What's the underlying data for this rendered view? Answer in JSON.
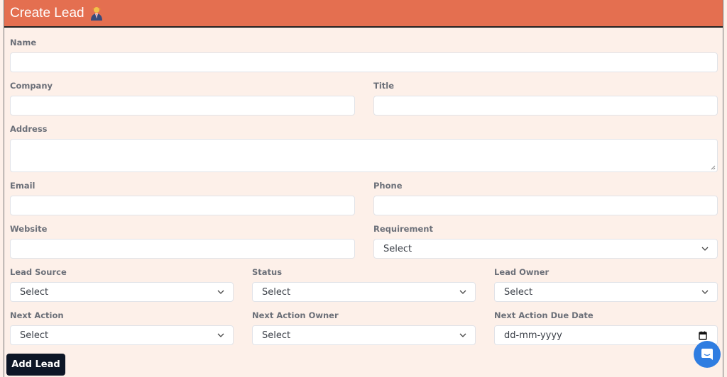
{
  "header": {
    "title": "Create Lead",
    "icon": "businessman-icon"
  },
  "fields": {
    "name": {
      "label": "Name",
      "value": ""
    },
    "company": {
      "label": "Company",
      "value": ""
    },
    "title": {
      "label": "Title",
      "value": ""
    },
    "address": {
      "label": "Address",
      "value": ""
    },
    "email": {
      "label": "Email",
      "value": ""
    },
    "phone": {
      "label": "Phone",
      "value": ""
    },
    "website": {
      "label": "Website",
      "value": ""
    },
    "requirement": {
      "label": "Requirement",
      "selected": "Select"
    },
    "lead_source": {
      "label": "Lead Source",
      "selected": "Select"
    },
    "status": {
      "label": "Status",
      "selected": "Select"
    },
    "lead_owner": {
      "label": "Lead Owner",
      "selected": "Select"
    },
    "next_action": {
      "label": "Next Action",
      "selected": "Select"
    },
    "next_action_owner": {
      "label": "Next Action Owner",
      "selected": "Select"
    },
    "next_action_due_date": {
      "label": "Next Action Due Date",
      "placeholder": "dd-mm-yyyy"
    }
  },
  "actions": {
    "add_lead_label": "Add Lead"
  },
  "widgets": {
    "chat_icon": "chat-icon"
  },
  "colors": {
    "header_bg": "#e46f50",
    "panel_bg": "#fdf0e9",
    "button_bg": "#0d1626",
    "chat_bg": "#2f7de1"
  }
}
